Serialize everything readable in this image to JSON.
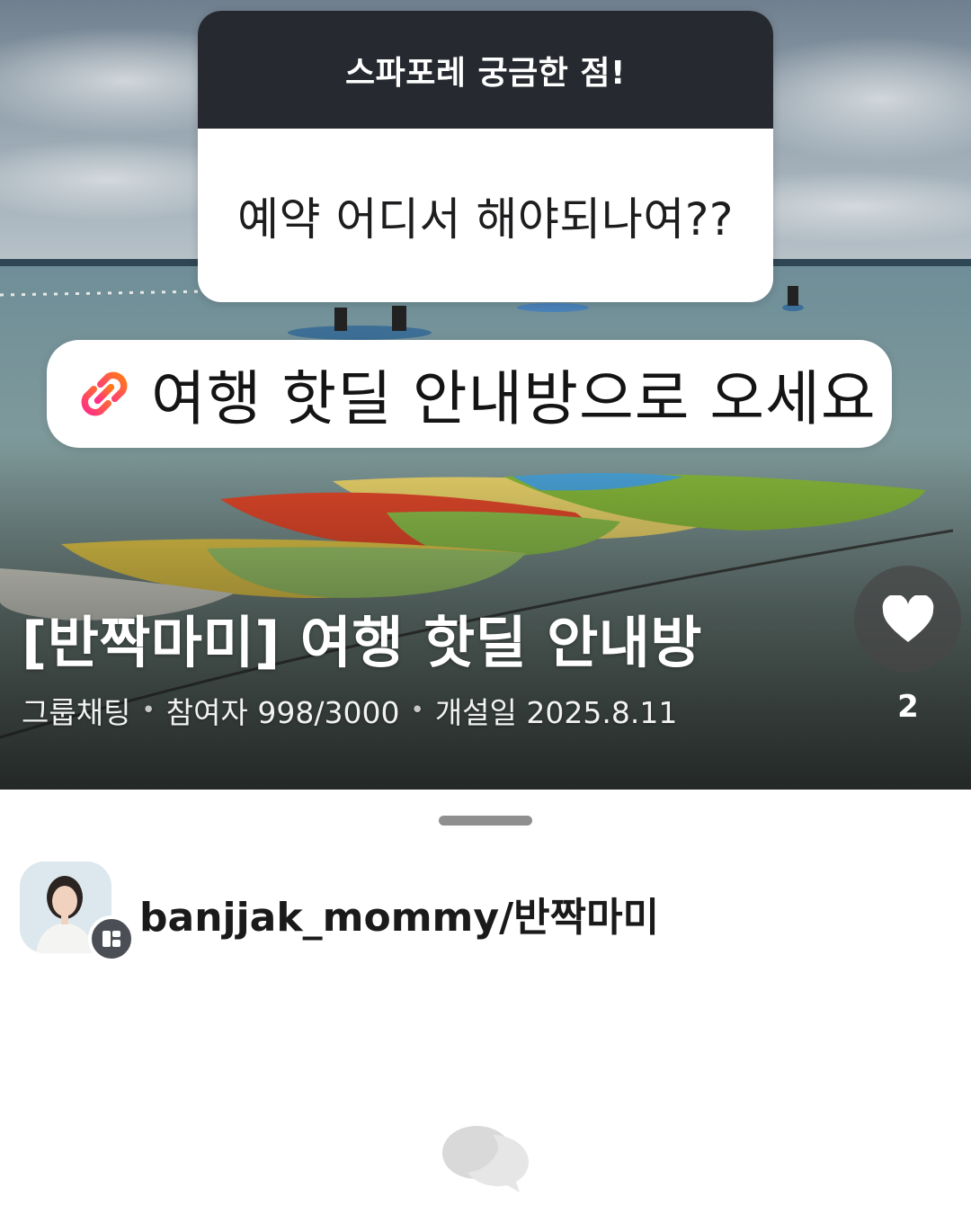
{
  "question_sticker": {
    "header": "스파포레 궁금한 점!",
    "question": "예약 어디서 해야되나여??"
  },
  "link_sticker": {
    "icon": "link-icon",
    "label": "여행 핫딜 안내방으로 오세요"
  },
  "chat_room": {
    "title": "[반짝마미] 여행 핫딜 안내방",
    "type": "그룹채팅",
    "participants": "참여자 998/3000",
    "created": "개설일 2025.8.11",
    "separator": "•",
    "like_icon": "heart-icon",
    "like_count": "2"
  },
  "host": {
    "name": "banjjak_mommy/반짝마미",
    "badge_icon": "host-badge-icon"
  },
  "footer": {
    "icon": "chat-bubbles-icon"
  },
  "colors": {
    "header_dark": "#262a30",
    "link_gradient_start": "#ff2d8a",
    "link_gradient_end": "#ff7a1a",
    "like_bg": "#464646"
  }
}
